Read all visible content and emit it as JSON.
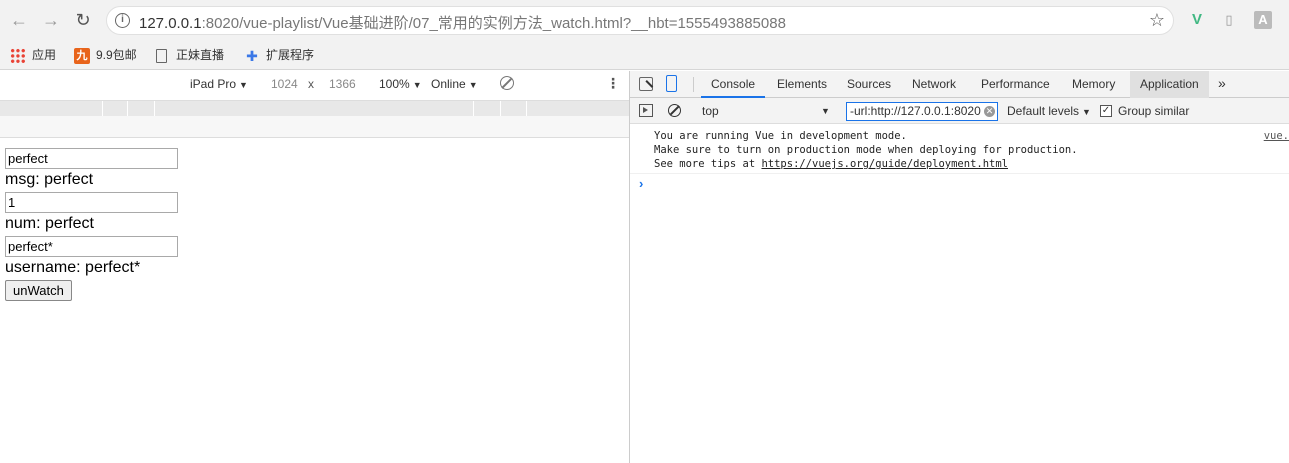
{
  "browser": {
    "url_host": "127.0.0.1",
    "url_rest": ":8020/vue-playlist/Vue基础进阶/07_常用的实例方法_watch.html?__hbt=1555493885088"
  },
  "bookmarks": [
    {
      "label": "应用"
    },
    {
      "label": "9.9包邮"
    },
    {
      "label": "正妹直播"
    },
    {
      "label": "扩展程序"
    }
  ],
  "bookmark_nine_glyph": "九",
  "device_toolbar": {
    "device": "iPad Pro",
    "width": "1024",
    "times": "x",
    "height": "1366",
    "zoom": "100%",
    "network": "Online"
  },
  "page": {
    "msg_input": "perfect",
    "msg_text": "msg: perfect",
    "num_input": "1",
    "num_text": "num: perfect",
    "username_input": "perfect*",
    "username_text": "username: perfect*",
    "unwatch_label": "unWatch"
  },
  "devtools": {
    "tabs": [
      {
        "label": "Console"
      },
      {
        "label": "Elements"
      },
      {
        "label": "Sources"
      },
      {
        "label": "Network"
      },
      {
        "label": "Performance"
      },
      {
        "label": "Memory"
      },
      {
        "label": "Application"
      }
    ],
    "more_tabs": "»",
    "context": "top",
    "filter": "-url:http://127.0.0.1:8020",
    "levels": "Default levels",
    "group_similar": "Group similar",
    "log": {
      "line1": "You are running Vue in development mode.",
      "line2": "Make sure to turn on production mode when deploying for production.",
      "line3_prefix": "See more tips at ",
      "line3_link": "https://vuejs.org/guide/deployment.html",
      "source": "vue."
    },
    "prompt": "›"
  },
  "colors": {
    "accent": "#1a73e8",
    "vue_green": "#41b883"
  }
}
